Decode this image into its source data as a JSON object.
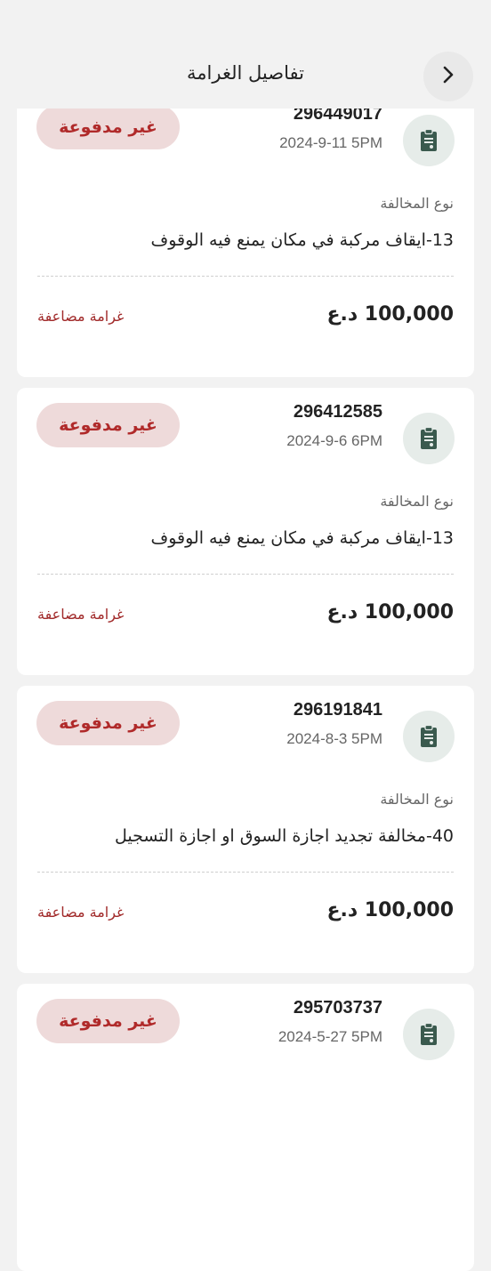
{
  "header": {
    "title": "تفاصيل الغرامة",
    "back_icon": "chevron-right-icon"
  },
  "labels": {
    "violation_type": "نوع المخالفة",
    "currency": "د.ع",
    "double_fine": "غرامة مضاعفة"
  },
  "colors": {
    "unpaid_badge_bg": "#eedada",
    "unpaid_badge_text": "#b02a2a",
    "icon_circle_bg": "#e6ece9",
    "icon_color": "#3a5a4e",
    "double_fine_text": "#a12a2a"
  },
  "fines": [
    {
      "number": "296449017",
      "date": "2024-9-11 5PM",
      "status": "غير مدفوعة",
      "violation": "13-ايقاف مركبة في مكان يمنع فيه الوقوف",
      "amount": "100,000",
      "icon": "clipboard-icon"
    },
    {
      "number": "296412585",
      "date": "2024-9-6 6PM",
      "status": "غير مدفوعة",
      "violation": "13-ايقاف مركبة في مكان يمنع فيه الوقوف",
      "amount": "100,000",
      "icon": "clipboard-icon"
    },
    {
      "number": "296191841",
      "date": "2024-8-3 5PM",
      "status": "غير مدفوعة",
      "violation": "40-مخالفة تجديد اجازة السوق او اجازة التسجيل",
      "amount": "100,000",
      "icon": "clipboard-icon"
    },
    {
      "number": "295703737",
      "date": "2024-5-27 5PM",
      "status": "غير مدفوعة",
      "violation": "",
      "amount": "",
      "icon": "clipboard-icon"
    }
  ]
}
